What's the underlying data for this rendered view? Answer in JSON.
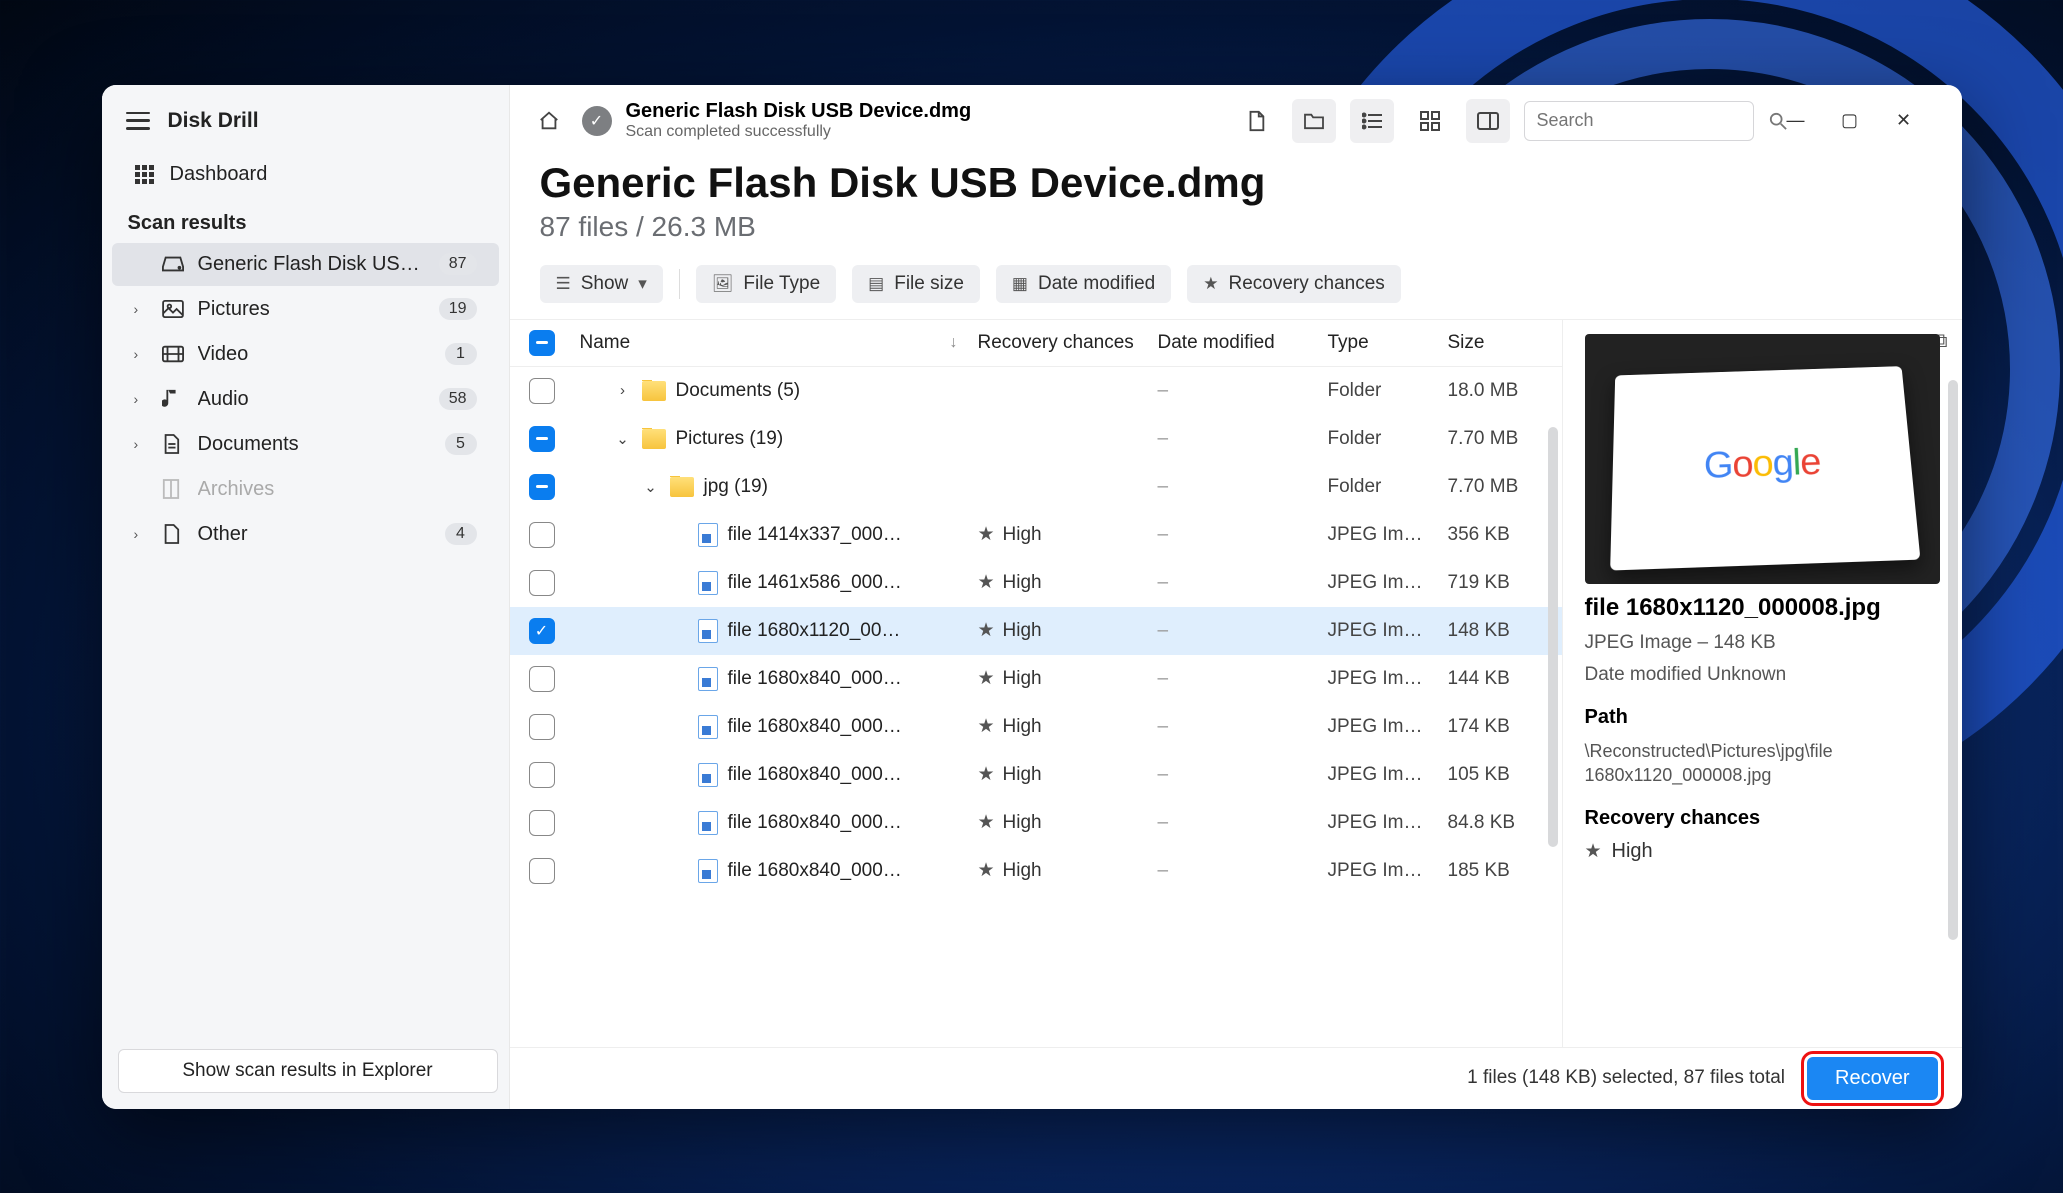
{
  "app": {
    "title": "Disk Drill"
  },
  "sidebar": {
    "dashboard_label": "Dashboard",
    "section_label": "Scan results",
    "items": [
      {
        "icon": "drive",
        "label": "Generic Flash Disk USB D…",
        "badge": "87",
        "active": true,
        "expandable": false
      },
      {
        "icon": "image",
        "label": "Pictures",
        "badge": "19",
        "expandable": true
      },
      {
        "icon": "video",
        "label": "Video",
        "badge": "1",
        "expandable": true
      },
      {
        "icon": "audio",
        "label": "Audio",
        "badge": "58",
        "expandable": true
      },
      {
        "icon": "doc",
        "label": "Documents",
        "badge": "5",
        "expandable": true
      },
      {
        "icon": "archive",
        "label": "Archives",
        "badge": "",
        "disabled": true
      },
      {
        "icon": "other",
        "label": "Other",
        "badge": "4",
        "expandable": true
      }
    ],
    "bottom_button": "Show scan results in Explorer"
  },
  "topbar": {
    "title": "Generic Flash Disk USB Device.dmg",
    "subtitle": "Scan completed successfully",
    "search_placeholder": "Search"
  },
  "heading": {
    "title": "Generic Flash Disk USB Device.dmg",
    "subtitle": "87 files / 26.3 MB"
  },
  "chips": {
    "show": "Show",
    "items": [
      {
        "icon": "image",
        "label": "File Type"
      },
      {
        "icon": "doc",
        "label": "File size"
      },
      {
        "icon": "calendar",
        "label": "Date modified"
      },
      {
        "icon": "star",
        "label": "Recovery chances"
      }
    ]
  },
  "table": {
    "headers": {
      "name": "Name",
      "rc": "Recovery chances",
      "date": "Date modified",
      "type": "Type",
      "size": "Size"
    },
    "rows": [
      {
        "check": "off",
        "indent": 1,
        "expander": "right",
        "kind": "folder",
        "name": "Documents (5)",
        "rc": "",
        "date": "–",
        "type": "Folder",
        "size": "18.0 MB"
      },
      {
        "check": "ind",
        "indent": 1,
        "expander": "down",
        "kind": "folder",
        "name": "Pictures (19)",
        "rc": "",
        "date": "–",
        "type": "Folder",
        "size": "7.70 MB"
      },
      {
        "check": "ind",
        "indent": 2,
        "expander": "down",
        "kind": "folder",
        "name": "jpg (19)",
        "rc": "",
        "date": "–",
        "type": "Folder",
        "size": "7.70 MB"
      },
      {
        "check": "off",
        "indent": 3,
        "expander": "",
        "kind": "file",
        "name": "file 1414x337_000…",
        "rc": "High",
        "date": "–",
        "type": "JPEG Im…",
        "size": "356 KB"
      },
      {
        "check": "off",
        "indent": 3,
        "expander": "",
        "kind": "file",
        "name": "file 1461x586_000…",
        "rc": "High",
        "date": "–",
        "type": "JPEG Im…",
        "size": "719 KB"
      },
      {
        "check": "on",
        "indent": 3,
        "expander": "",
        "kind": "file",
        "name": "file 1680x1120_00…",
        "rc": "High",
        "date": "–",
        "type": "JPEG Im…",
        "size": "148 KB",
        "selected": true
      },
      {
        "check": "off",
        "indent": 3,
        "expander": "",
        "kind": "file",
        "name": "file 1680x840_000…",
        "rc": "High",
        "date": "–",
        "type": "JPEG Im…",
        "size": "144 KB"
      },
      {
        "check": "off",
        "indent": 3,
        "expander": "",
        "kind": "file",
        "name": "file 1680x840_000…",
        "rc": "High",
        "date": "–",
        "type": "JPEG Im…",
        "size": "174 KB"
      },
      {
        "check": "off",
        "indent": 3,
        "expander": "",
        "kind": "file",
        "name": "file 1680x840_000…",
        "rc": "High",
        "date": "–",
        "type": "JPEG Im…",
        "size": "105 KB"
      },
      {
        "check": "off",
        "indent": 3,
        "expander": "",
        "kind": "file",
        "name": "file 1680x840_000…",
        "rc": "High",
        "date": "–",
        "type": "JPEG Im…",
        "size": "84.8 KB"
      },
      {
        "check": "off",
        "indent": 3,
        "expander": "",
        "kind": "file",
        "name": "file 1680x840_000…",
        "rc": "High",
        "date": "–",
        "type": "JPEG Im…",
        "size": "185 KB"
      }
    ]
  },
  "preview": {
    "title": "file 1680x1120_000008.jpg",
    "meta": "JPEG Image – 148 KB",
    "date": "Date modified Unknown",
    "path_h": "Path",
    "path": "\\Reconstructed\\Pictures\\jpg\\file 1680x1120_000008.jpg",
    "rc_h": "Recovery chances",
    "rc": "High"
  },
  "footer": {
    "status": "1 files (148 KB) selected, 87 files total",
    "recover": "Recover"
  }
}
